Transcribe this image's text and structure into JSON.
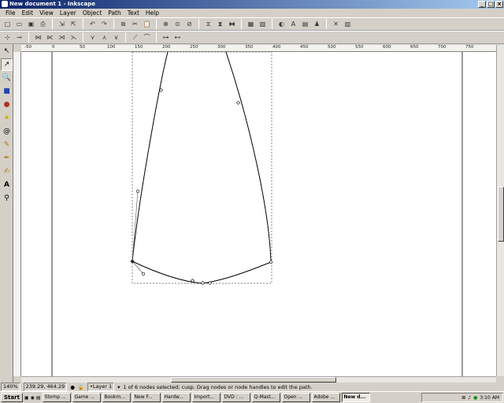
{
  "window": {
    "title": "New document 1 - Inkscape"
  },
  "menu": [
    "File",
    "Edit",
    "View",
    "Layer",
    "Object",
    "Path",
    "Text",
    "Help"
  ],
  "ruler": {
    "h_ticks": [
      "-50",
      "0",
      "50",
      "100",
      "150",
      "200",
      "250",
      "300",
      "350",
      "400",
      "450",
      "500",
      "550",
      "600",
      "650",
      "700",
      "750"
    ]
  },
  "status": {
    "zoom": "140%",
    "coords": "239.29, 464.29",
    "layer": "•Layer 1",
    "message": "1 of 6 nodes selected; cusp. Drag nodes or node handles to edit the path."
  },
  "taskbar": {
    "start": "Start",
    "tasks": [
      "Stomp ...",
      "Game ...",
      "Bookm...",
      "New F...",
      "Hardw...",
      "Import...",
      "DVD : ...",
      "Q-Mast...",
      "Open ...",
      "Adobe ...",
      "New d..."
    ],
    "clock": "3:10 AM"
  }
}
